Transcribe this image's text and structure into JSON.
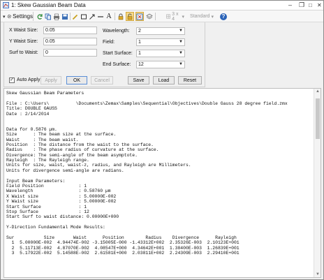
{
  "window": {
    "title": "1: Skew Gaussian Beam Data",
    "controls": {
      "minimize": "‒",
      "restore": "❐",
      "maximize": "□",
      "close": "✕"
    }
  },
  "toolbar": {
    "settings_label": "Settings",
    "grid_select": "3 x 4",
    "standard_select": "Standard",
    "tools": [
      "refresh",
      "copy",
      "print",
      "save",
      "draw-line",
      "rectangle",
      "arrow",
      "line",
      "text",
      "lock",
      "lock-open",
      "zoom-fit",
      "layers",
      "help"
    ]
  },
  "settings": {
    "x_waist_label": "X Waist Size:",
    "x_waist_value": "0.05",
    "y_waist_label": "Y Waist Size:",
    "y_waist_value": "0.05",
    "surf_waist_label": "Surf to Waist:",
    "surf_waist_value": "0",
    "wavelength_label": "Wavelength:",
    "wavelength_value": "2",
    "field_label": "Field:",
    "field_value": "1",
    "start_surface_label": "Start Surface:",
    "start_surface_value": "1",
    "end_surface_label": "End Surface:",
    "end_surface_value": "12",
    "auto_apply_label": "Auto Apply",
    "apply_label": "Apply",
    "ok_label": "OK",
    "cancel_label": "Cancel",
    "save_label": "Save",
    "load_label": "Load",
    "reset_label": "Reset"
  },
  "report": {
    "lines": [
      "Skew Gaussian Beam Parameters",
      "",
      "File : C:\\Users\\          \\Documents\\Zemax\\Samples\\Sequential\\Objectives\\Double Gauss 28 degree field.zmx",
      "Title: DOUBLE GAUSS",
      "Date : 2/14/2014",
      "",
      "",
      "Data for 0.5876 µm.",
      "Size      : The beam size at the surface.",
      "Waist     : The beam waist.",
      "Position  : The distance from the waist to the surface.",
      "Radius    : The phase radius of curvature at the surface.",
      "Divergence: The semi-angle of the beam asymptote.",
      "Rayleigh  : The Rayleigh range.",
      "Units for size, waist, waist-z, radius, and Rayleigh are Millimeters.",
      "Units for divergence semi-angle are radians.",
      "",
      "Input Beam Parameters:",
      "Field Position             : 1",
      "Wavelength                 : 0.58760 µm",
      "X Waist size               : 5.00000E-002",
      "Y Waist size               : 5.00000E-002",
      "Start Surface              : 1",
      "Stop Surface               : 12",
      "Start Surf to waist distance: 0.00000E+000",
      "",
      "Y-Direction Fundamental Mode Results:",
      "",
      "Sur           Size       Waist      Position        Radius    Divergence      Rayleigh",
      "  1  5.00000E-002  4.94474E-002 -3.15005E-000 -1.43312E+002  2.35326E-003  2.10123E+001",
      "  2  5.11713E-002  4.87070E-002  4.08547E+000  4.34642E+001  1.38400E-003  1.26839E+001",
      "  3  5.17922E-002  5.14588E-002  2.61581E+000  2.03811E+002  2.24309E-003  2.29410E+001"
    ]
  }
}
